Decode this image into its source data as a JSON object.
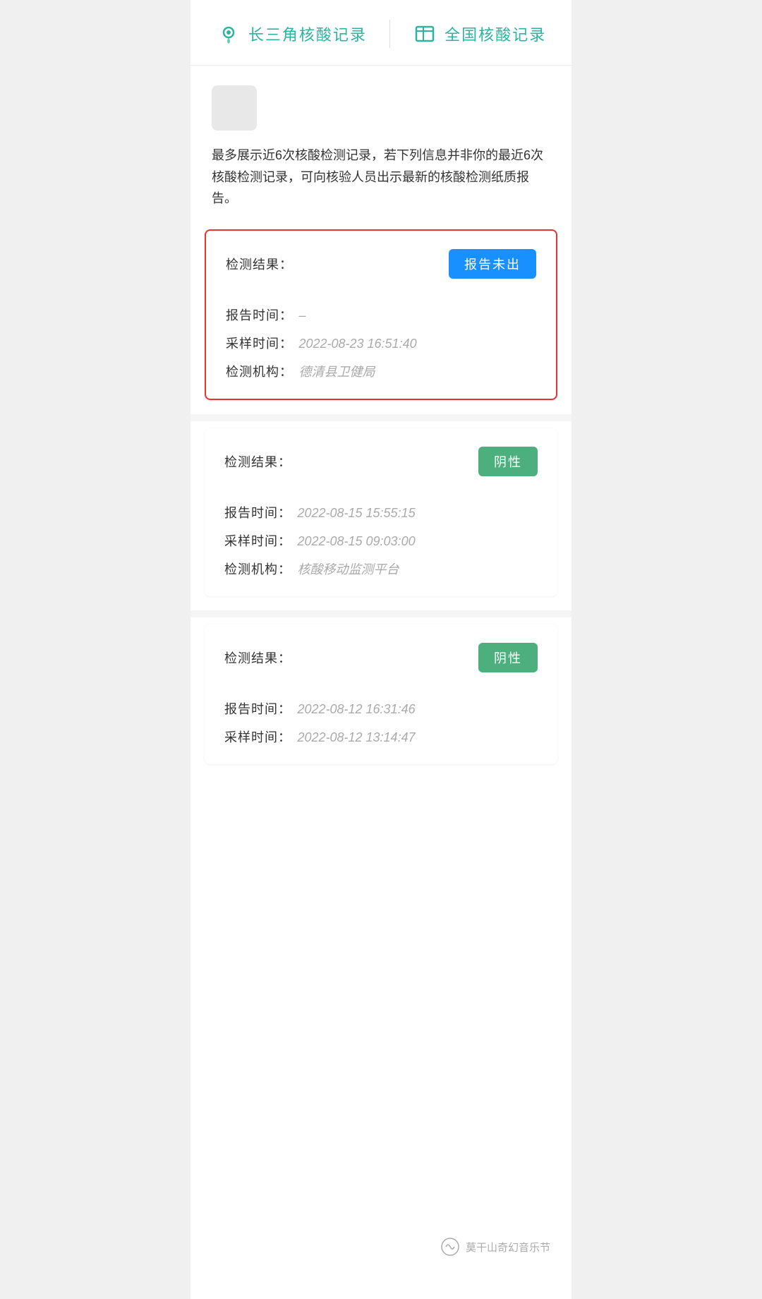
{
  "header": {
    "btn1_label": "长三角核酸记录",
    "btn2_label": "全国核酸记录"
  },
  "info_text": "最多展示近6次核酸检测记录，若下列信息并非你的最近6次核酸检测记录，可向核验人员出示最新的核酸检测纸质报告。",
  "records": [
    {
      "id": 1,
      "highlighted": true,
      "result_label": "检测结果：",
      "badge_text": "报告未出",
      "badge_type": "pending",
      "report_time_label": "报告时间：",
      "report_time_value": "–",
      "sample_time_label": "采样时间：",
      "sample_time_value": "2022-08-23 16:51:40",
      "institution_label": "检测机构：",
      "institution_value": "德清县卫健局"
    },
    {
      "id": 2,
      "highlighted": false,
      "result_label": "检测结果：",
      "badge_text": "阴性",
      "badge_type": "negative",
      "report_time_label": "报告时间：",
      "report_time_value": "2022-08-15 15:55:15",
      "sample_time_label": "采样时间：",
      "sample_time_value": "2022-08-15 09:03:00",
      "institution_label": "检测机构：",
      "institution_value": "核酸移动监测平台"
    },
    {
      "id": 3,
      "highlighted": false,
      "result_label": "检测结果：",
      "badge_text": "阴性",
      "badge_type": "negative",
      "report_time_label": "报告时间：",
      "report_time_value": "2022-08-12 16:31:46",
      "sample_time_label": "采样时间：",
      "sample_time_value": "2022-08-12 13:14:47",
      "institution_label": "检测机构：",
      "institution_value": ""
    }
  ],
  "watermark": {
    "text": "莫干山奇幻音乐节"
  }
}
